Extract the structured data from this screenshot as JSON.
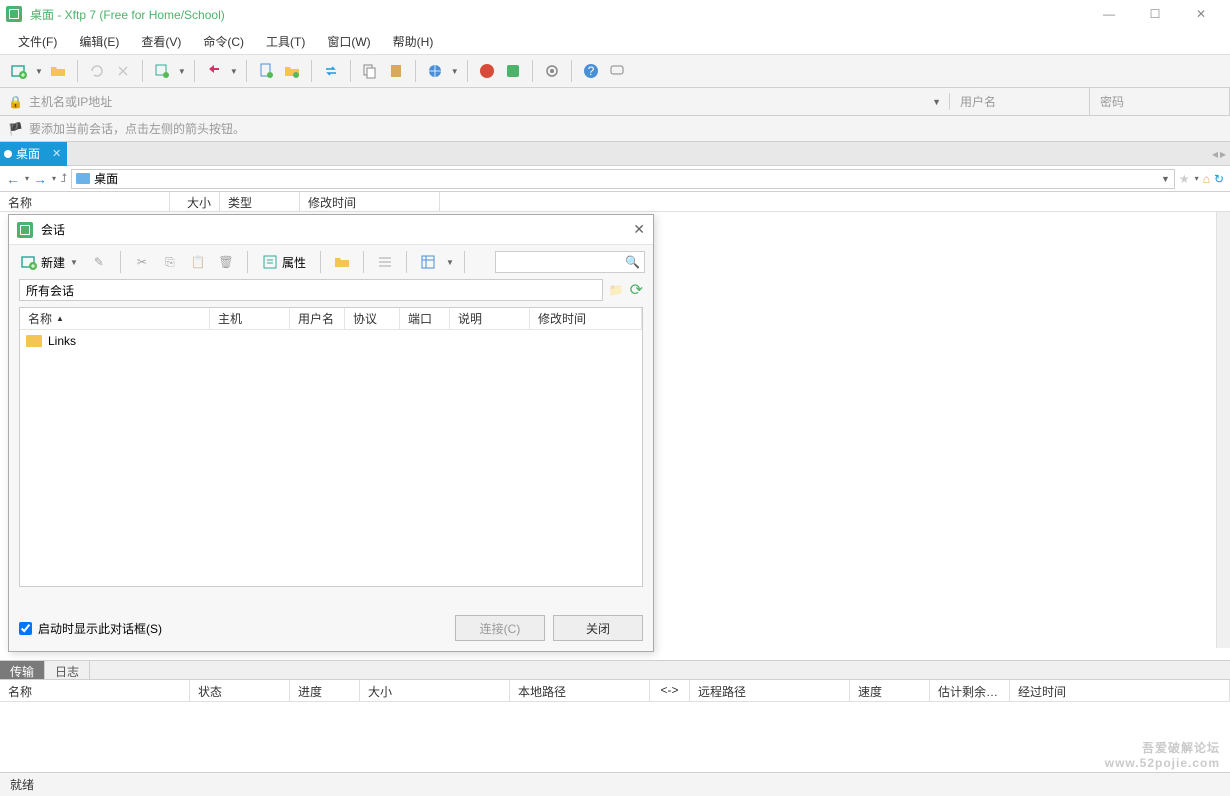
{
  "window": {
    "title": "桌面 - Xftp 7 (Free for Home/School)"
  },
  "menu": [
    "文件(F)",
    "编辑(E)",
    "查看(V)",
    "命令(C)",
    "工具(T)",
    "窗口(W)",
    "帮助(H)"
  ],
  "conn": {
    "host_placeholder": "主机名或IP地址",
    "user_placeholder": "用户名",
    "pass_placeholder": "密码"
  },
  "hint": "要添加当前会话，点击左侧的箭头按钮。",
  "tab": {
    "label": "桌面"
  },
  "nav": {
    "path": "桌面"
  },
  "filecols": {
    "name": "名称",
    "size": "大小",
    "type": "类型",
    "mtime": "修改时间"
  },
  "dialog": {
    "title": "会话",
    "new": "新建",
    "props": "属性",
    "addr": "所有会话",
    "cols": {
      "name": "名称",
      "host": "主机",
      "user": "用户名",
      "proto": "协议",
      "port": "端口",
      "desc": "说明",
      "mtime": "修改时间"
    },
    "row1": "Links",
    "show_on_start": "启动时显示此对话框(S)",
    "connect": "连接(C)",
    "close": "关闭"
  },
  "logtabs": {
    "transfer": "传输",
    "log": "日志"
  },
  "transcols": {
    "name": "名称",
    "status": "状态",
    "progress": "进度",
    "size": "大小",
    "local": "本地路径",
    "arrow": "<->",
    "remote": "远程路径",
    "speed": "速度",
    "eta": "估计剩余…",
    "elapsed": "经过时间"
  },
  "status": "就绪",
  "watermark1": "吾爱破解论坛",
  "watermark2": "www.52pojie.com"
}
